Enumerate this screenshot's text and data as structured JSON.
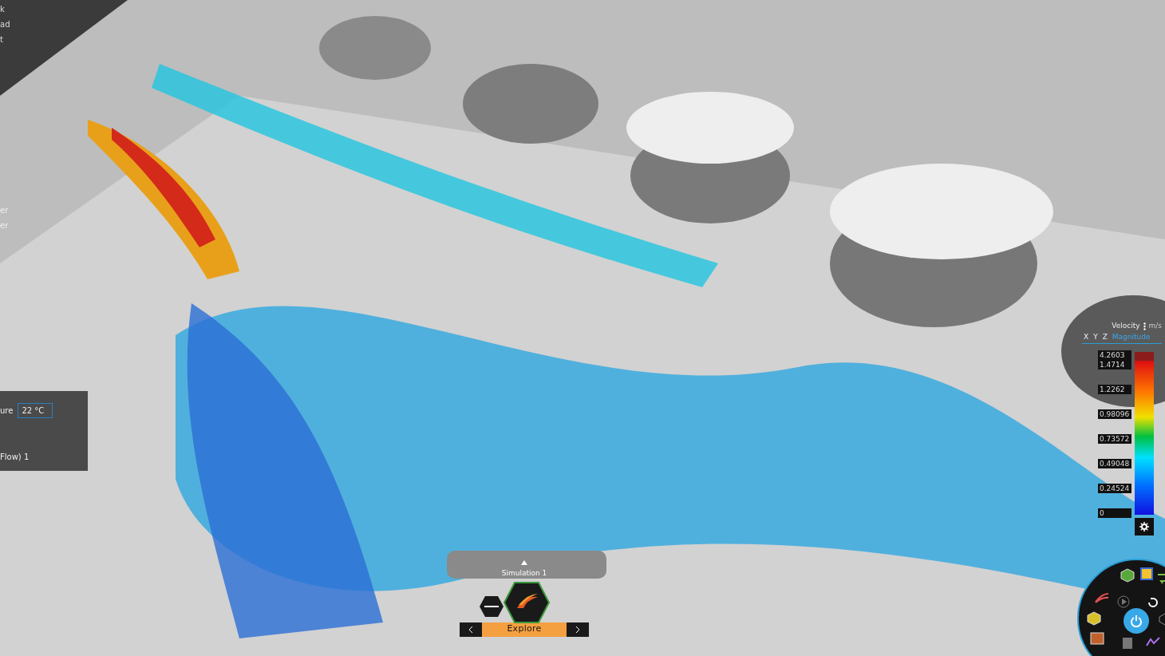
{
  "left_panel": {
    "labels": [
      "k",
      "ad",
      "t",
      "er",
      "er"
    ],
    "temperature": {
      "label": "ure",
      "value": "22 °C"
    },
    "item": "Flow) 1"
  },
  "legend": {
    "quantity": "Velocity",
    "unit": "m/s",
    "components": [
      {
        "label": "X",
        "selected": false
      },
      {
        "label": "Y",
        "selected": false
      },
      {
        "label": "Z",
        "selected": false
      },
      {
        "label": "Magnitude",
        "selected": true
      }
    ],
    "max": "4.2603",
    "ticks": [
      "1.4714",
      "1.2262",
      "0.98096",
      "0.73572",
      "0.49048",
      "0.24524",
      "0"
    ]
  },
  "simulation": {
    "title": "Simulation 1",
    "mode": "Explore"
  }
}
